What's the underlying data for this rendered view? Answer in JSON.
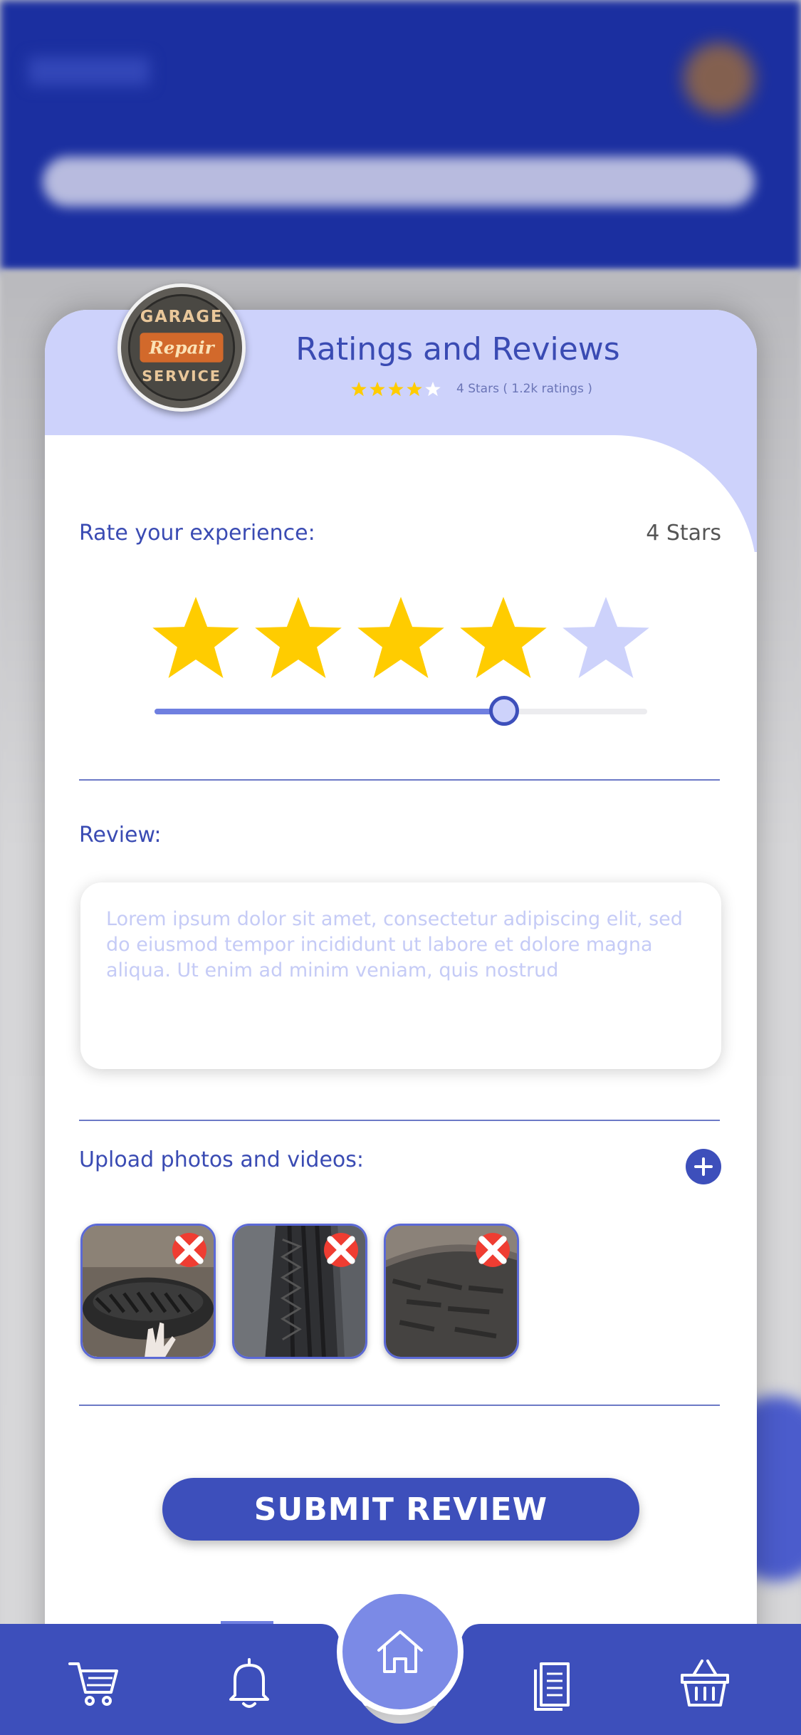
{
  "header": {
    "title": "Ratings and Reviews",
    "rating_summary": "4 Stars ( 1.2k ratings )",
    "mini_stars_filled": 4,
    "logo_text_top": "GARAGE",
    "logo_text_mid": "Repair",
    "logo_text_bottom": "SERVICE"
  },
  "rate": {
    "label": "Rate your experience:",
    "value_text": "4 Stars",
    "stars_filled": 4,
    "stars_total": 5,
    "slider_fraction": 0.71
  },
  "review": {
    "label": "Review:",
    "placeholder": "Lorem ipsum dolor sit amet, consectetur adipiscing elit, sed do eiusmod tempor incididunt ut labore et dolore magna aliqua. Ut enim ad minim veniam, quis nostrud"
  },
  "upload": {
    "label": "Upload photos and videos:",
    "photos": [
      "tire-photo-1",
      "tire-photo-2",
      "tire-photo-3"
    ]
  },
  "submit_label": "SUBMIT REVIEW",
  "nav": {
    "items": [
      "cart-icon",
      "bell-icon",
      "home-icon",
      "document-icon",
      "basket-icon"
    ]
  },
  "colors": {
    "primary": "#3d4fbb",
    "star": "#ffcc00",
    "star_empty": "#cdd2fb",
    "remove": "#ef3d32",
    "head_bg": "#cdd2fb"
  }
}
